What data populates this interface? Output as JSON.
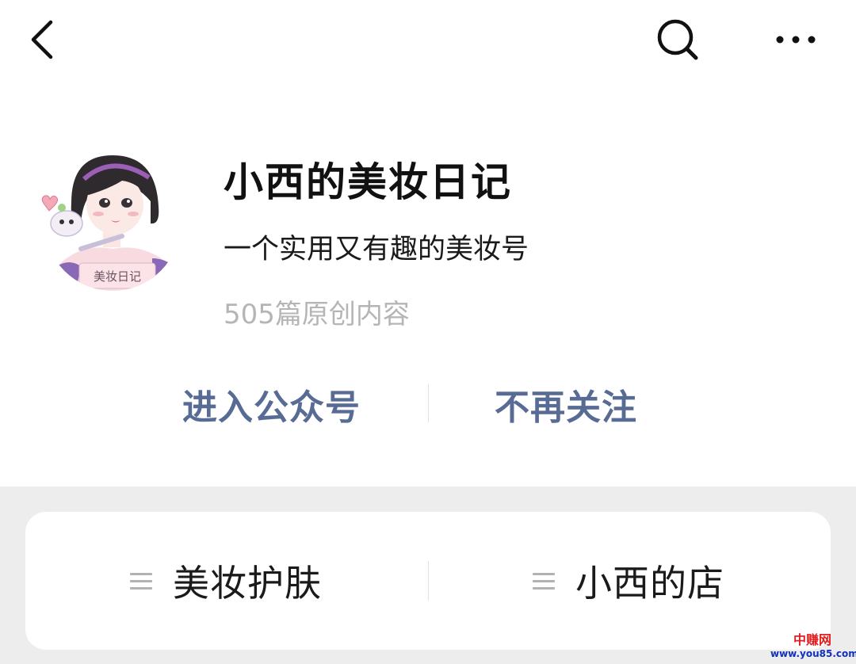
{
  "nav": {
    "back_icon": "back-chevron-icon",
    "search_icon": "search-icon",
    "more_icon": "more-dots-icon"
  },
  "profile": {
    "avatar_text": "美妆日记",
    "name": "小西的美妆日记",
    "description": "一个实用又有趣的美妆号",
    "original_count": "505篇原创内容"
  },
  "actions": {
    "enter_label": "进入公众号",
    "unfollow_label": "不再关注",
    "link_color": "#576b95"
  },
  "menu": {
    "items": [
      {
        "label": "美妆护肤",
        "icon": "menu-list-icon"
      },
      {
        "label": "小西的店",
        "icon": "menu-list-icon"
      }
    ]
  },
  "watermark": {
    "text": "中赚网",
    "url": "www.you85.com"
  }
}
